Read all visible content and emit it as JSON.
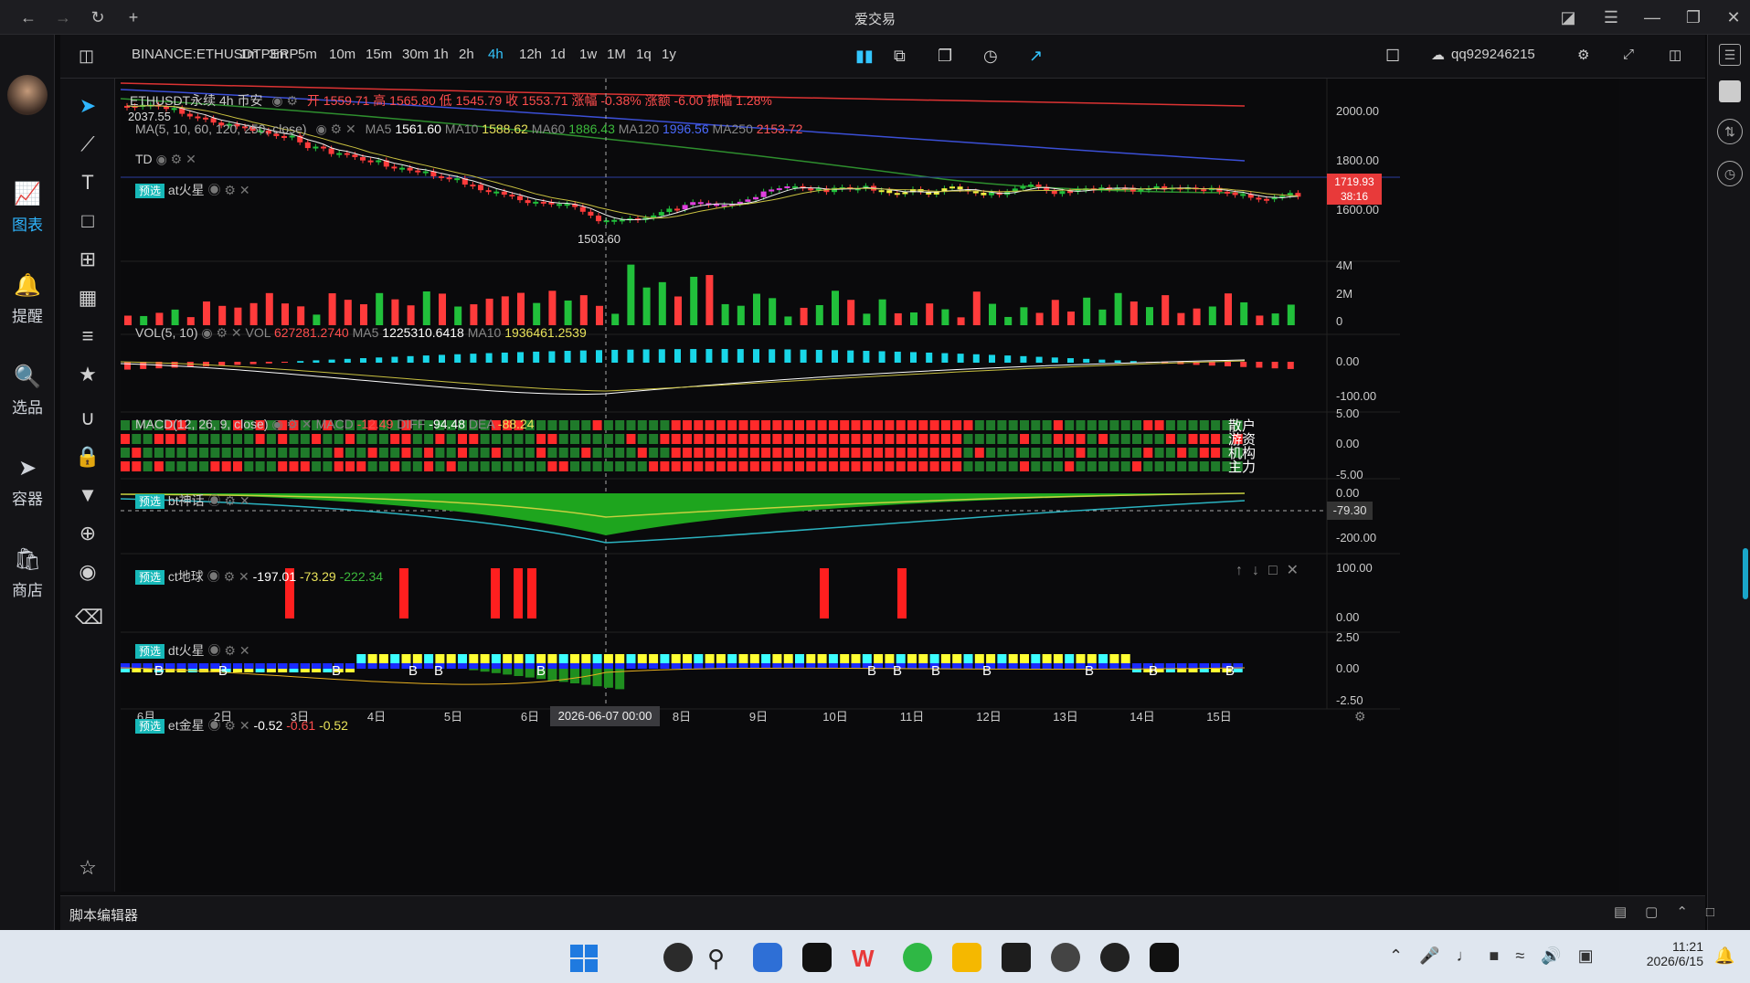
{
  "window": {
    "title": "爱交易"
  },
  "nav": [
    {
      "label": "图表",
      "icon": "chart-icon"
    },
    {
      "label": "提醒",
      "icon": "bell-icon"
    },
    {
      "label": "选品",
      "icon": "search-icon"
    },
    {
      "label": "容器",
      "icon": "container-icon"
    },
    {
      "label": "商店",
      "icon": "store-icon"
    }
  ],
  "toolbar": {
    "symbol": "BINANCE:ETHUSDTPERP",
    "timeframes": [
      "1m",
      "3m",
      "5m",
      "10m",
      "15m",
      "30m",
      "1h",
      "2h",
      "4h",
      "12h",
      "1d",
      "1w",
      "1M",
      "1q",
      "1y"
    ],
    "selected_tf": "4h",
    "user": "qq929246215"
  },
  "main_legend": {
    "name": "ETHUSDT永续 4h 币安",
    "ohlc": "开 1559.71 高 1565.80 低 1545.79 收 1553.71 涨幅 -0.38% 涨额 -6.00 振幅 1.28%"
  },
  "ma_legend": {
    "name": "MA(5, 10, 60, 120, 250, close)",
    "ma5_label": "MA5",
    "ma5": "1561.60",
    "ma10_label": "MA10",
    "ma10": "1588.62",
    "ma60_label": "MA60",
    "ma60": "1886.43",
    "ma120_label": "MA120",
    "ma120": "1996.56",
    "ma250_label": "MA250",
    "ma250": "2153.72"
  },
  "td_legend": "TD",
  "at_legend": {
    "tag": "预选",
    "name": "at火星"
  },
  "price_axis": [
    "2000.00",
    "1800.00",
    "1600.00"
  ],
  "price_top_label": "2037.55",
  "low_label": "1503.60",
  "last_price": {
    "price": "1719.93",
    "countdown": "38:16"
  },
  "vol": {
    "name": "VOL(5, 10)",
    "vol_label": "VOL",
    "vol": "627281.2740",
    "ma5_label": "MA5",
    "ma5": "1225310.6418",
    "ma10_label": "MA10",
    "ma10": "1936461.2539",
    "axis": [
      "4M",
      "2M",
      "0"
    ]
  },
  "macd": {
    "name": "MACD(12, 26, 9, close)",
    "macd_label": "MACD",
    "macd": "-12.49",
    "diff_label": "DIFF",
    "diff": "-94.48",
    "dea_label": "DEA",
    "dea": "-88.24",
    "axis": [
      "0.00",
      "-100.00"
    ]
  },
  "bt": {
    "tag": "预选",
    "name": "bt神话",
    "rows": [
      "散户",
      "游资",
      "机构",
      "主力"
    ],
    "axis": [
      "5.00",
      "0.00",
      "-5.00"
    ]
  },
  "ct": {
    "tag": "预选",
    "name": "ct地球",
    "v1": "-197.01",
    "v2": "-73.29",
    "v3": "-222.34",
    "axis": [
      "0.00",
      "-200.00"
    ],
    "cursor": "-79.30"
  },
  "dt": {
    "tag": "预选",
    "name": "dt火星",
    "axis": [
      "100.00",
      "0.00"
    ]
  },
  "et": {
    "tag": "预选",
    "name": "et金星",
    "v1": "-0.52",
    "v2": "-0.61",
    "v3": "-0.52",
    "axis": [
      "2.50",
      "0.00",
      "-2.50"
    ]
  },
  "dates": [
    "6月",
    "2日",
    "3日",
    "4日",
    "5日",
    "6日",
    "8日",
    "9日",
    "10日",
    "11日",
    "12日",
    "13日",
    "14日",
    "15日"
  ],
  "crosshair_date": "2026-06-07  00:00",
  "script_editor": "脚本编辑器",
  "clock": {
    "time": "11:21",
    "date": "2026/6/15"
  },
  "colors": {
    "up": "#21c03b",
    "down": "#ff3b3b",
    "accent": "#2fb6ff"
  }
}
